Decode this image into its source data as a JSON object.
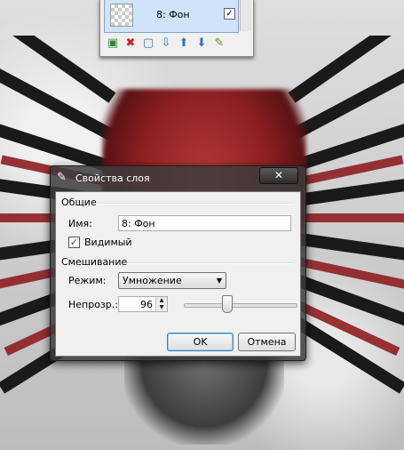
{
  "layers_panel": {
    "layer_name": "8: Фон",
    "layer_visible": true,
    "tools": [
      "add-layer-icon",
      "delete-layer-icon",
      "duplicate-layer-icon",
      "merge-down-icon",
      "move-up-icon",
      "move-down-icon",
      "properties-icon"
    ]
  },
  "dialog": {
    "title": "Свойства слоя",
    "close_label": "✕",
    "general_group": "Общие",
    "name_label": "Имя:",
    "name_value": "8: Фон",
    "visible_label": "Видимый",
    "visible_checked": true,
    "blending_group": "Смешивание",
    "mode_label": "Режим:",
    "mode_value": "Умножение",
    "opacity_label": "Непрозр.:",
    "opacity_value": "96",
    "opacity_slider_fraction": 0.38,
    "ok_label": "OK",
    "cancel_label": "Отмена"
  },
  "colors": {
    "dialog_frame": "#3c3c3c",
    "artwork_red": "#8e1f22"
  }
}
